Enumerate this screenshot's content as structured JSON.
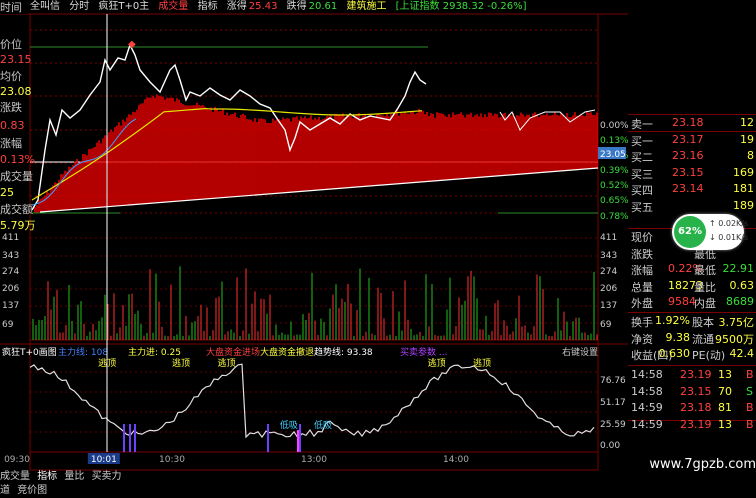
{
  "top_bar": {
    "tabs": [
      "全叫信",
      "分时",
      "疯狂T+0主",
      "成交量",
      "指标"
    ],
    "active_tab": "成交量",
    "rise_label": "涨得",
    "rise_value": "25.43",
    "fall_label": "跌得",
    "fall_value": "20.61",
    "sector": "建筑施工",
    "index_info": "[上证指数 2938.32 -0.26%]"
  },
  "left_labels": {
    "time": "时间",
    "price": "价位",
    "price_val": "23.15",
    "avg": "均价",
    "avg_val": "23.08",
    "change": "涨跌",
    "change_val": "0.83",
    "change_pct": "涨幅",
    "change_pct_val": "0.13%",
    "vol": "成交量",
    "vol_val": "25",
    "amount": "成交额",
    "amount_val": "5.79万"
  },
  "price_axis_right": [
    "0.00%",
    "0.13%",
    "0.26%",
    "0.39%",
    "0.52%",
    "0.65%",
    "0.78%"
  ],
  "current_price_tag": "23.05",
  "volume_axis_left": [
    "411",
    "343",
    "274",
    "206",
    "137",
    "69"
  ],
  "volume_axis_right": [
    "411",
    "343",
    "274",
    "206",
    "137",
    "69"
  ],
  "indicator": {
    "name": "疯狂T+0画图",
    "items": [
      {
        "label": "主力线: 108",
        "color": "#4080ff"
      },
      {
        "label": "主力进: 0.25",
        "color": "#ffff40"
      },
      {
        "label": "大盘资金进场",
        "color": "#ff4040"
      },
      {
        "label": "大盘资金撤退",
        "color": "#ffff40"
      },
      {
        "label": "趋势线: 93.38",
        "color": "#ffffff"
      },
      {
        "label": "买卖参数 ...",
        "color": "#b040ff"
      }
    ],
    "settings_label": "右键设置",
    "axis": [
      "76.76",
      "51.17",
      "25.59",
      "0.00"
    ],
    "markers": [
      {
        "text": "逃顶",
        "t": 0.12
      },
      {
        "text": "逃顶",
        "t": 0.25
      },
      {
        "text": "逃顶",
        "t": 0.33
      },
      {
        "text": "逃顶",
        "t": 0.7
      },
      {
        "text": "逃顶",
        "t": 0.78
      },
      {
        "text": "低吸",
        "t": 0.44
      },
      {
        "text": "低吸",
        "t": 0.5
      }
    ]
  },
  "time_axis": [
    {
      "label": "09:30",
      "t": 0.0
    },
    {
      "label": "10:01",
      "t": 0.13
    },
    {
      "label": "10:30",
      "t": 0.25
    },
    {
      "label": "13:00",
      "t": 0.5
    },
    {
      "label": "14:00",
      "t": 0.75
    }
  ],
  "orderbook": [
    {
      "label": "卖一",
      "price": "23.18",
      "vol": "12",
      "pcolor": "#ff4040"
    },
    {
      "label": "买一",
      "price": "23.17",
      "vol": "19",
      "pcolor": "#ff4040"
    },
    {
      "label": "买二",
      "price": "23.16",
      "vol": "8",
      "pcolor": "#ff4040"
    },
    {
      "label": "买三",
      "price": "23.15",
      "vol": "169",
      "pcolor": "#ff4040"
    },
    {
      "label": "买四",
      "price": "23.14",
      "vol": "181",
      "pcolor": "#ff4040"
    },
    {
      "label": "买五",
      "price": "",
      "vol": "189",
      "pcolor": "#ff4040"
    }
  ],
  "stats": [
    {
      "l1": "现价",
      "v1": "",
      "l2": "",
      "v2": "",
      "c1": "#ff4040"
    },
    {
      "l1": "涨跌",
      "v1": "",
      "l2": "最低",
      "v2": "",
      "c1": "#ff4040"
    },
    {
      "l1": "涨幅",
      "v1": "0.22%",
      "l2": "最低",
      "v2": "22.91",
      "c1": "#ff4040"
    },
    {
      "l1": "总量",
      "v1": "18273",
      "l2": "量比",
      "v2": "0.63",
      "c1": "#ffff40"
    },
    {
      "l1": "外盘",
      "v1": "9584",
      "l2": "内盘",
      "v2": "8689",
      "c1": "#ff4040"
    }
  ],
  "fundamentals": [
    {
      "l1": "换手",
      "v1": "1.92%",
      "l2": "股本",
      "v2": "3.75亿"
    },
    {
      "l1": "净资",
      "v1": "9.38",
      "l2": "流通",
      "v2": "9500万"
    },
    {
      "l1": "收益(四)",
      "v1": "0.630",
      "l2": "PE(动)",
      "v2": "42.4"
    }
  ],
  "ticks": [
    {
      "time": "14:58",
      "price": "23.19",
      "vol": "13",
      "side": "B",
      "sc": "#ff4040"
    },
    {
      "time": "14:58",
      "price": "23.15",
      "vol": "70",
      "side": "S",
      "sc": "#3adf3a"
    },
    {
      "time": "14:59",
      "price": "23.18",
      "vol": "81",
      "side": "B",
      "sc": "#ff4040"
    },
    {
      "time": "14:59",
      "price": "23.19",
      "vol": "13",
      "side": "B",
      "sc": "#ff4040"
    }
  ],
  "widget": {
    "percent": "62%",
    "up": "0.02K/s",
    "down": "0.01K/s"
  },
  "bottom_tabs": [
    "成交量",
    "指标",
    "量比",
    "买卖力道",
    "竞价图"
  ],
  "active_bottom_tab": "指标",
  "watermark": "www.7gpzb.com"
}
